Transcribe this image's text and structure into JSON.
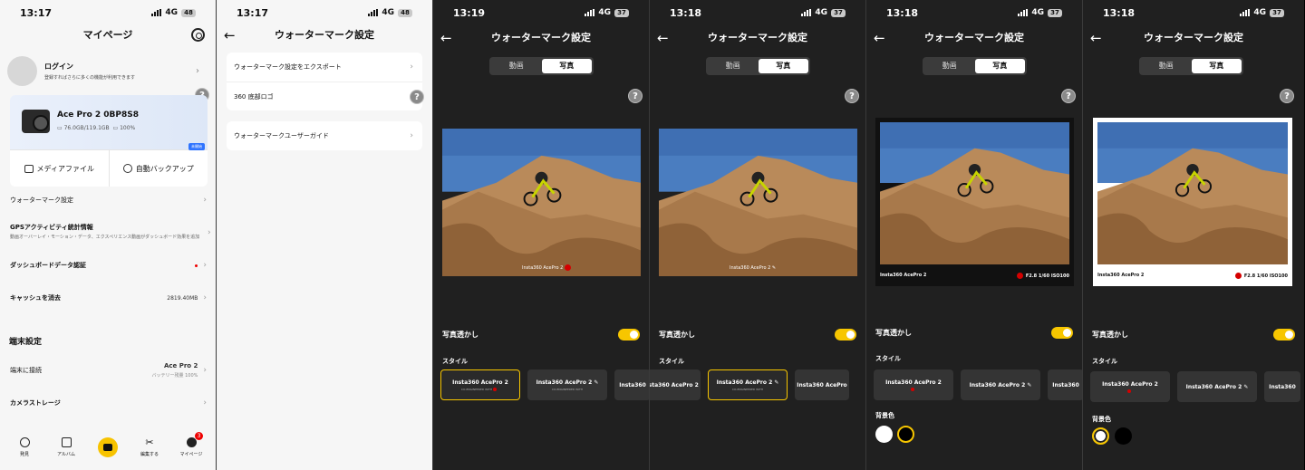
{
  "colors": {
    "accent": "#f7c600",
    "dark_bg": "#202020",
    "light_bg": "#f6f6f6",
    "badge_red": "#e00000",
    "leica_red": "#d40000"
  },
  "p1": {
    "time": "13:17",
    "net": "4G",
    "battery": "48",
    "title": "マイページ",
    "login": {
      "title": "ログイン",
      "subtitle": "登録すればさらに多くの機能が利用できます"
    },
    "device": {
      "name": "Ace Pro 2 0BP8S8",
      "storage": "76.0GB/119.1GB",
      "battery": "100%"
    },
    "actions": {
      "media": "メディアファイル",
      "backup": "自動バックアップ",
      "new_badge": "未開始"
    },
    "rows": {
      "watermark": "ウォーターマーク設定",
      "gps": "GPSアクティビティ統計情報",
      "gps_sub": "動画オーバーレイ・モーション・データ、エクスペリエンス動画がダッシュボード効果を追加",
      "dashboard": "ダッシュボードデータ認証",
      "cache": "キャッシュを消去",
      "cache_value": "2819.40MB"
    },
    "section": "端末設定",
    "connect": {
      "label": "端末に接続",
      "device": "Ace Pro 2",
      "battery": "バッテリー残量 100%"
    },
    "storage": "カメラストレージ",
    "tabs": {
      "discover": "発見",
      "album": "アルバム",
      "edit": "編集する",
      "mypage": "マイページ",
      "badge": "3"
    }
  },
  "p2": {
    "time": "13:17",
    "net": "4G",
    "battery": "48",
    "title": "ウォーターマーク設定",
    "items": {
      "export": "ウォーターマーク設定をエクスポート",
      "logo": "360 底部ロゴ",
      "guide": "ウォーターマークユーザーガイド"
    }
  },
  "dark": [
    {
      "time": "13:19",
      "net": "4G",
      "battery": "37"
    },
    {
      "time": "13:18",
      "net": "4G",
      "battery": "37"
    },
    {
      "time": "13:18",
      "net": "4G",
      "battery": "37"
    },
    {
      "time": "13:18",
      "net": "4G",
      "battery": "37"
    }
  ],
  "common": {
    "title": "ウォーターマーク設定",
    "tab_video": "動画",
    "tab_photo": "写真",
    "toggle": "写真透かし",
    "style": "スタイル",
    "bgcolor": "背景色",
    "wm_brand": "Insta360",
    "wm_ace": "Ace",
    "wm_pro": "Pro",
    "wm_2": "2",
    "exif": "F2.8  1/60  ISO100",
    "wm_caption": "CO-ENGINEERED WITH"
  }
}
